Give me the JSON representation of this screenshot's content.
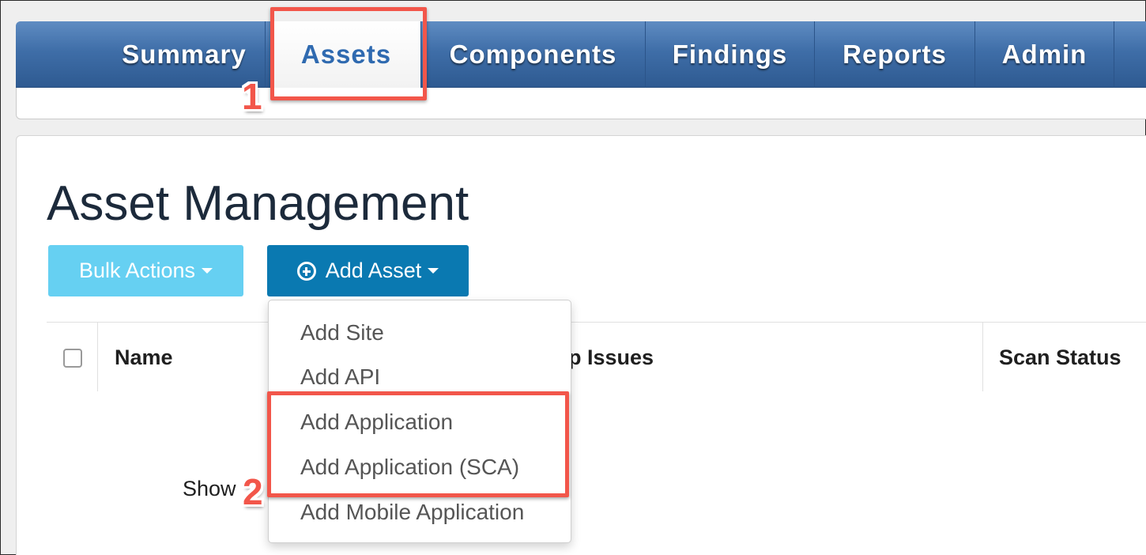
{
  "nav": {
    "tabs": [
      {
        "label": "Summary"
      },
      {
        "label": "Assets"
      },
      {
        "label": "Components"
      },
      {
        "label": "Findings"
      },
      {
        "label": "Reports"
      },
      {
        "label": "Admin"
      }
    ],
    "active_tab": "Assets"
  },
  "annotations": {
    "step1": "1",
    "step2": "2",
    "highlight_color": "#f2564a"
  },
  "page": {
    "title": "Asset Management"
  },
  "toolbar": {
    "bulk_actions_label": "Bulk Actions",
    "add_asset_label": "Add Asset",
    "add_asset_icon": "plus-circle-icon",
    "bulk_color": "#66d0f2",
    "add_color": "#0a79b1"
  },
  "dropdown": {
    "items": [
      {
        "label": "Add Site"
      },
      {
        "label": "Add API"
      },
      {
        "label": "Add Application"
      },
      {
        "label": "Add Application (SCA)"
      },
      {
        "label": "Add Mobile Application"
      }
    ]
  },
  "table": {
    "columns": [
      {
        "label": "Name"
      },
      {
        "label": "p Issues"
      },
      {
        "label": "Scan Status"
      }
    ],
    "show_label": "Show"
  }
}
